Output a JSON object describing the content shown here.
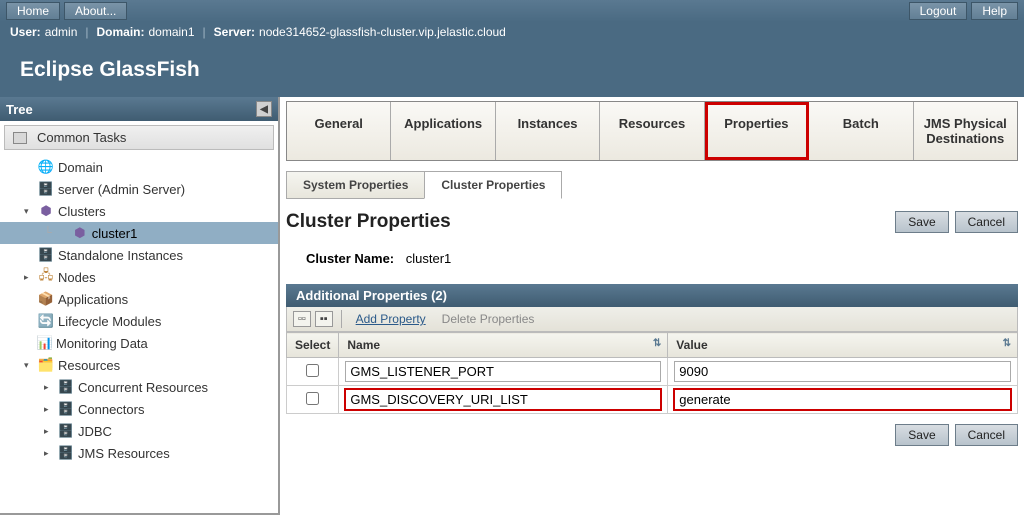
{
  "topbar": {
    "home": "Home",
    "about": "About...",
    "logout": "Logout",
    "help": "Help"
  },
  "info": {
    "user_lbl": "User:",
    "user": "admin",
    "domain_lbl": "Domain:",
    "domain": "domain1",
    "server_lbl": "Server:",
    "server": "node314652-glassfish-cluster.vip.jelastic.cloud"
  },
  "brand": "Eclipse GlassFish",
  "tree": {
    "header": "Tree",
    "common_tasks": "Common Tasks",
    "nodes": [
      {
        "label": "Domain",
        "icon": "globe",
        "indent": 1
      },
      {
        "label": "server (Admin Server)",
        "icon": "server",
        "indent": 1
      },
      {
        "label": "Clusters",
        "icon": "cluster",
        "indent": 1,
        "toggle": "▾"
      },
      {
        "label": "cluster1",
        "icon": "cluster",
        "indent": 2,
        "selected": true,
        "line": true
      },
      {
        "label": "Standalone Instances",
        "icon": "server",
        "indent": 1
      },
      {
        "label": "Nodes",
        "icon": "node",
        "indent": 1,
        "toggle": "▸"
      },
      {
        "label": "Applications",
        "icon": "pkg",
        "indent": 1
      },
      {
        "label": "Lifecycle Modules",
        "icon": "cycle",
        "indent": 1
      },
      {
        "label": "Monitoring Data",
        "icon": "mon",
        "indent": 1
      },
      {
        "label": "Resources",
        "icon": "res",
        "indent": 1,
        "toggle": "▾"
      },
      {
        "label": "Concurrent Resources",
        "icon": "db",
        "indent": 2,
        "toggle": "▸"
      },
      {
        "label": "Connectors",
        "icon": "db",
        "indent": 2,
        "toggle": "▸"
      },
      {
        "label": "JDBC",
        "icon": "db",
        "indent": 2,
        "toggle": "▸"
      },
      {
        "label": "JMS Resources",
        "icon": "db",
        "indent": 2,
        "toggle": "▸"
      }
    ]
  },
  "tabs_outer": [
    "General",
    "Applications",
    "Instances",
    "Resources",
    "Properties",
    "Batch",
    "JMS Physical Destinations"
  ],
  "tabs_outer_active": 4,
  "tabs_inner": [
    "System Properties",
    "Cluster Properties"
  ],
  "tabs_inner_active": 1,
  "page": {
    "title": "Cluster Properties",
    "save": "Save",
    "cancel": "Cancel",
    "cluster_name_lbl": "Cluster Name:",
    "cluster_name": "cluster1"
  },
  "panel": {
    "header": "Additional Properties (2)",
    "add": "Add Property",
    "delete": "Delete Properties",
    "cols": {
      "select": "Select",
      "name": "Name",
      "value": "Value"
    },
    "rows": [
      {
        "name": "GMS_LISTENER_PORT",
        "value": "9090",
        "hl": false
      },
      {
        "name": "GMS_DISCOVERY_URI_LIST",
        "value": "generate",
        "hl": true
      }
    ]
  }
}
